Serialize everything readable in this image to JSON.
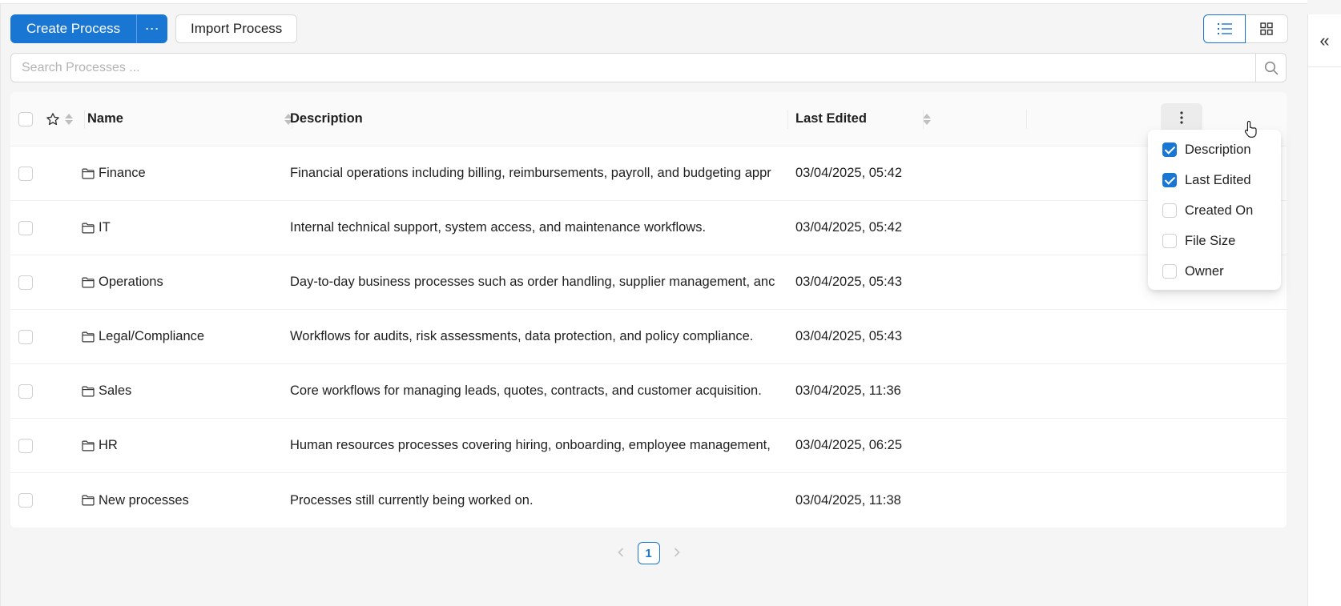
{
  "toolbar": {
    "create_label": "Create Process",
    "more_label": "⋯",
    "import_label": "Import Process"
  },
  "view_toggle": {
    "list_icon": "list-icon",
    "grid_icon": "grid-icon",
    "active": "list"
  },
  "search": {
    "placeholder": "Search Processes ...",
    "value": ""
  },
  "table": {
    "columns": {
      "name": "Name",
      "description": "Description",
      "last_edited": "Last Edited"
    },
    "rows": [
      {
        "name": "Finance",
        "description": "Financial operations including billing, reimbursements, payroll, and budgeting appr",
        "last_edited": "03/04/2025, 05:42"
      },
      {
        "name": "IT",
        "description": "Internal technical support, system access, and maintenance workflows.",
        "last_edited": "03/04/2025, 05:42"
      },
      {
        "name": "Operations",
        "description": "Day-to-day business processes such as order handling, supplier management, anc",
        "last_edited": "03/04/2025, 05:43"
      },
      {
        "name": "Legal/Compliance",
        "description": "Workflows for audits, risk assessments, data protection, and policy compliance.",
        "last_edited": "03/04/2025, 05:43"
      },
      {
        "name": "Sales",
        "description": "Core workflows for managing leads, quotes, contracts, and customer acquisition.",
        "last_edited": "03/04/2025, 11:36"
      },
      {
        "name": "HR",
        "description": "Human resources processes covering hiring, onboarding, employee management,",
        "last_edited": "03/04/2025, 06:25"
      },
      {
        "name": "New processes",
        "description": "Processes still currently being worked on.",
        "last_edited": "03/04/2025, 11:38"
      }
    ]
  },
  "column_menu": {
    "items": [
      {
        "label": "Description",
        "checked": true
      },
      {
        "label": "Last Edited",
        "checked": true
      },
      {
        "label": "Created On",
        "checked": false
      },
      {
        "label": "File Size",
        "checked": false
      },
      {
        "label": "Owner",
        "checked": false
      }
    ]
  },
  "pagination": {
    "current_page": "1"
  },
  "side_panel": {
    "collapse_label": "«"
  },
  "colors": {
    "primary": "#1976d2",
    "background": "#f5f5f5"
  }
}
